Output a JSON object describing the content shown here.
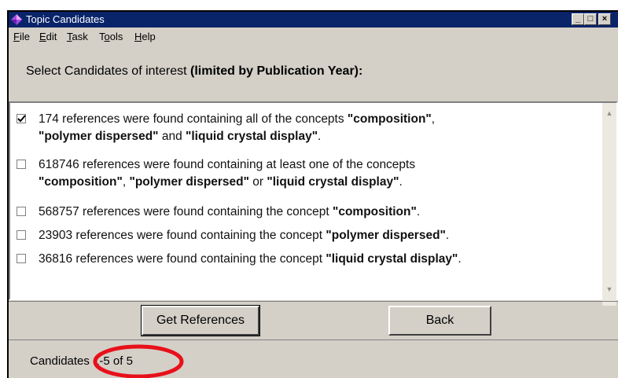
{
  "window": {
    "title": "Topic Candidates"
  },
  "menu": [
    {
      "label": "File",
      "mnemonic": "F",
      "rest": "ile"
    },
    {
      "label": "Edit",
      "mnemonic": "E",
      "rest": "dit"
    },
    {
      "label": "Task",
      "mnemonic": "T",
      "rest": "ask"
    },
    {
      "label": "Tools",
      "mnemonic": "o",
      "prefix": "T",
      "rest": "ols"
    },
    {
      "label": "Help",
      "mnemonic": "H",
      "rest": "elp"
    }
  ],
  "heading": {
    "plain": "Select Candidates of interest ",
    "bold": "(limited by Publication Year):"
  },
  "candidates": [
    {
      "checked": true,
      "line1": [
        {
          "t": "174 references were found containing all of the concepts "
        },
        {
          "t": "\"composition\"",
          "b": true
        },
        {
          "t": ","
        }
      ],
      "line2": [
        {
          "t": "\"polymer dispersed\"",
          "b": true
        },
        {
          "t": " and "
        },
        {
          "t": "\"liquid crystal display\"",
          "b": true
        },
        {
          "t": "."
        }
      ]
    },
    {
      "checked": false,
      "line1": [
        {
          "t": "618746 references were found containing at least one of the concepts"
        }
      ],
      "line2": [
        {
          "t": "\"composition\"",
          "b": true
        },
        {
          "t": ", "
        },
        {
          "t": "\"polymer dispersed\"",
          "b": true
        },
        {
          "t": " or "
        },
        {
          "t": "\"liquid crystal display\"",
          "b": true
        },
        {
          "t": "."
        }
      ]
    },
    {
      "checked": false,
      "line1": [
        {
          "t": "568757 references were found containing the concept "
        },
        {
          "t": "\"composition\"",
          "b": true
        },
        {
          "t": "."
        }
      ]
    },
    {
      "checked": false,
      "line1": [
        {
          "t": "23903 references were found containing the concept "
        },
        {
          "t": "\"polymer dispersed\"",
          "b": true
        },
        {
          "t": "."
        }
      ]
    },
    {
      "checked": false,
      "line1": [
        {
          "t": "36816 references were found containing the concept "
        },
        {
          "t": "\"liquid crystal display\"",
          "b": true
        },
        {
          "t": "."
        }
      ]
    }
  ],
  "buttons": {
    "get_references": "Get References",
    "back": "Back"
  },
  "status": {
    "text": "Candidates 1-5 of 5"
  },
  "icons": {
    "app": "diamond-app-icon",
    "minimize": "minimize-icon",
    "maximize": "maximize-icon",
    "close": "close-icon"
  },
  "colors": {
    "titlebar": "#0a246a",
    "window": "#d4d0c8",
    "annotation": "#e8101a"
  }
}
